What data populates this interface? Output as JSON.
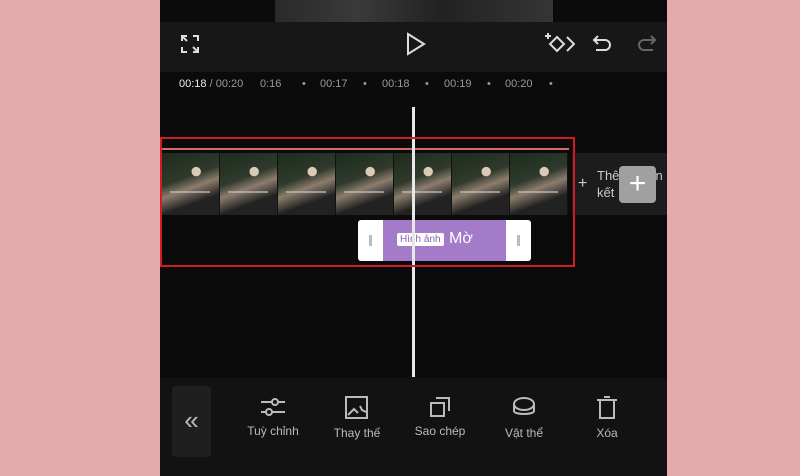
{
  "header": {
    "icons": [
      "fullscreen-icon",
      "play-icon",
      "keyframe-icon",
      "undo-icon",
      "redo-icon"
    ]
  },
  "timeline": {
    "current_time": "00:18",
    "total_time": "/ 00:20",
    "ticks": [
      "0:16",
      "00:17",
      "00:18",
      "00:19",
      "00:20"
    ],
    "add_ending_label": "Thêm phần kết",
    "sticker_tag": "Hình ảnh",
    "sticker_label": "Mờ"
  },
  "toolbar": {
    "items": [
      {
        "label": "Tuỳ chỉnh",
        "icon": "sliders-icon"
      },
      {
        "label": "Thay thế",
        "icon": "replace-image-icon"
      },
      {
        "label": "Sao chép",
        "icon": "copy-icon"
      },
      {
        "label": "Vật thể",
        "icon": "object-icon"
      },
      {
        "label": "Xóa",
        "icon": "trash-icon"
      }
    ]
  },
  "colors": {
    "highlight": "#d21c24",
    "sticker": "#a47bc8",
    "background": "#e3abab"
  }
}
